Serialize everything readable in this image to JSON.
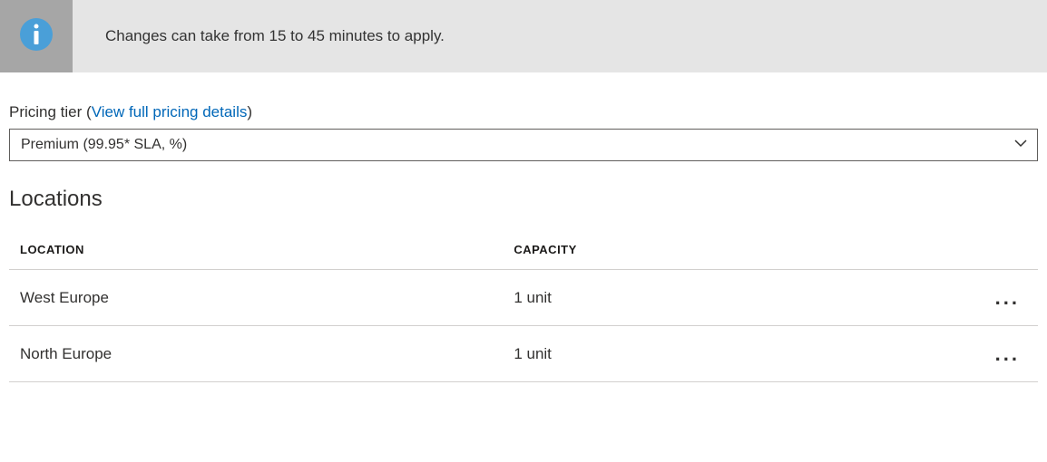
{
  "banner": {
    "message": "Changes can take from 15 to 45 minutes to apply."
  },
  "pricing": {
    "label_prefix": "Pricing tier (",
    "link_text": "View full pricing details",
    "label_suffix": ")",
    "selected": "Premium (99.95* SLA, %)"
  },
  "locations": {
    "heading": "Locations",
    "columns": {
      "location": "LOCATION",
      "capacity": "CAPACITY"
    },
    "rows": [
      {
        "location": "West Europe",
        "capacity": "1 unit"
      },
      {
        "location": "North Europe",
        "capacity": "1 unit"
      }
    ]
  }
}
